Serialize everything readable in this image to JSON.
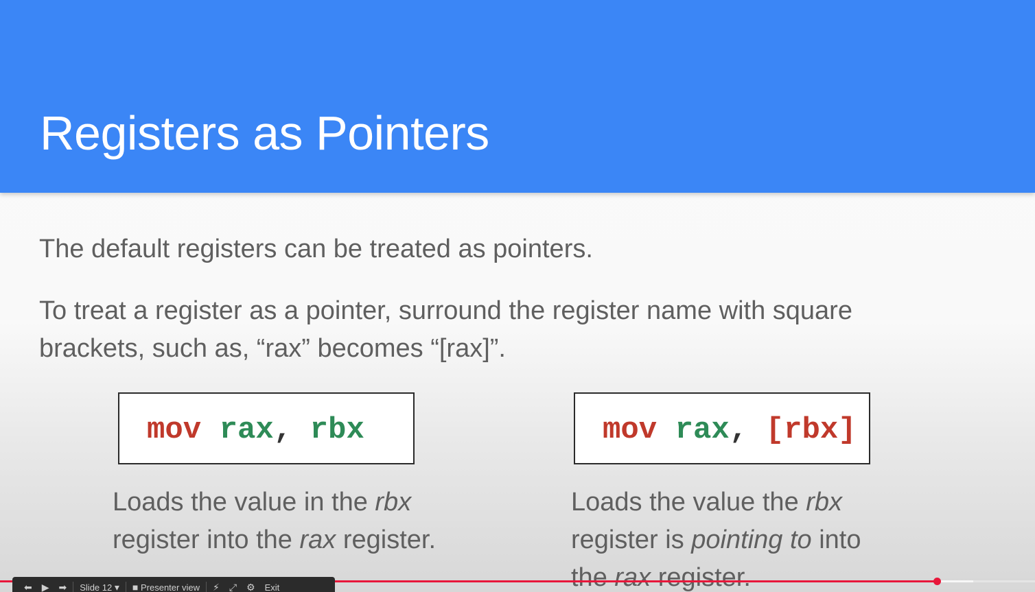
{
  "slide": {
    "title": "Registers as Pointers",
    "paragraph1": "The default registers can be treated as pointers.",
    "paragraph2": "To treat a register as a pointer, surround the register name with square brackets, such as, “rax” becomes “[rax]”.",
    "left_example": {
      "code_keyword": "mov",
      "code_dest": "rax",
      "code_comma": ",",
      "code_src": "rbx",
      "caption_before": "Loads the value in the ",
      "caption_em1": "rbx",
      "caption_mid": " register into the ",
      "caption_em2": "rax",
      "caption_after": " register."
    },
    "right_example": {
      "code_keyword": "mov",
      "code_dest": "rax",
      "code_comma": ",",
      "code_bracket_open": "[",
      "code_src": "rbx",
      "code_bracket_close": "]",
      "caption_before": "Loads the value the ",
      "caption_em1": "rbx",
      "caption_mid": " register is ",
      "caption_em2": "pointing to",
      "caption_mid2": " into the ",
      "caption_em3": "rax",
      "caption_after": " register."
    }
  },
  "presenter_toolbar": {
    "slide_label": "Slide 12",
    "presenter_view_label": "Presenter view",
    "exit_label": "Exit"
  },
  "video": {
    "progress_percent": 90.6
  },
  "colors": {
    "header_blue": "#3b86f6",
    "code_keyword": "#c0392b",
    "code_register": "#2e8b57",
    "progress_red": "#e8173a"
  },
  "icons": {
    "prev": "arrow-left-icon",
    "play": "play-icon",
    "next": "arrow-right-icon",
    "presenter": "presenter-icon",
    "laser": "laser-pointer-icon",
    "fullscreen": "fullscreen-icon",
    "settings": "gear-icon"
  }
}
